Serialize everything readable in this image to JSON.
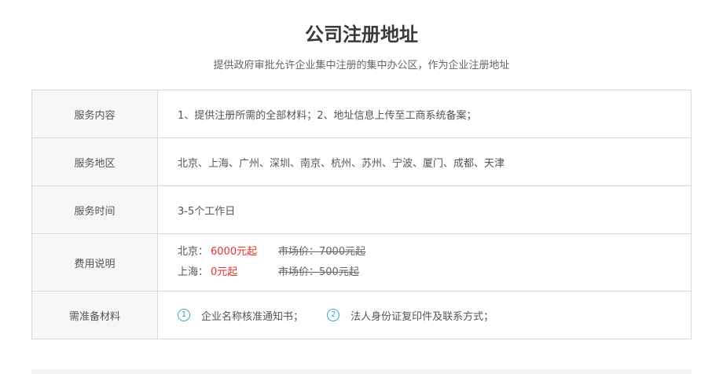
{
  "section": {
    "title": "公司注册地址",
    "subtitle": "提供政府审批允许企业集中注册的集中办公区，作为企业注册地址"
  },
  "rows": {
    "content": {
      "label": "服务内容",
      "value": "1、提供注册所需的全部材料；2、地址信息上传至工商系统备案；"
    },
    "region": {
      "label": "服务地区",
      "value": "北京、上海、广州、深圳、南京、杭州、苏州、宁波、厦门、成都、天津"
    },
    "time": {
      "label": "服务时间",
      "value": "3-5个工作日"
    },
    "fee": {
      "label": "费用说明",
      "items": [
        {
          "city": "北京：",
          "price": "6000元起",
          "market": "市场价：7000元起"
        },
        {
          "city": "上海：",
          "price": "0元起",
          "market": "市场价：500元起"
        }
      ]
    },
    "materials": {
      "label": "需准备材料",
      "items": [
        {
          "num": "1",
          "text": "企业名称核准通知书；"
        },
        {
          "num": "2",
          "text": "法人身份证复印件及联系方式；"
        }
      ]
    }
  },
  "colors": {
    "price": "#e0342f",
    "icon": "#3aa3c9",
    "label_bg": "#f7f7f7",
    "border": "#d8d8d8"
  }
}
